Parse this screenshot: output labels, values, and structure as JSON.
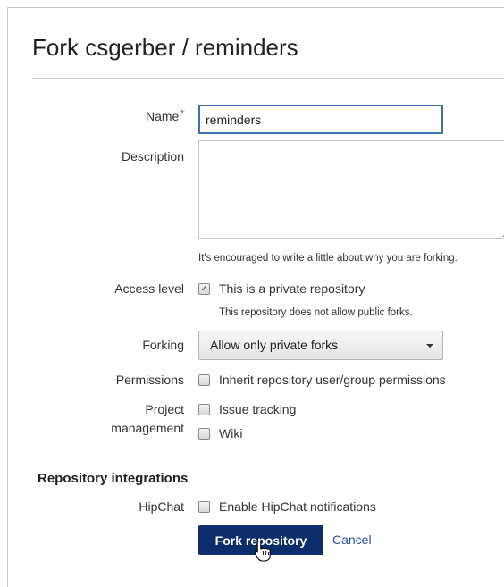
{
  "page": {
    "title": "Fork csgerber / reminders"
  },
  "form": {
    "name_label": "Name",
    "required_mark": "*",
    "name_value": "reminders",
    "description_label": "Description",
    "description_value": "",
    "description_help": "It's encouraged to write a little about why you are forking.",
    "access_label": "Access level",
    "access_checkbox_label": "This is a private repository",
    "access_checked": true,
    "access_help": "This repository does not allow public forks.",
    "forking_label": "Forking",
    "forking_selected": "Allow only private forks",
    "permissions_label": "Permissions",
    "permissions_checkbox_label": "Inherit repository user/group permissions",
    "project_label_line1": "Project",
    "project_label_line2": "management",
    "issue_tracking_label": "Issue tracking",
    "wiki_label": "Wiki"
  },
  "integrations": {
    "heading": "Repository integrations",
    "hipchat_label": "HipChat",
    "hipchat_checkbox_label": "Enable HipChat notifications"
  },
  "actions": {
    "fork_label": "Fork repository",
    "cancel_label": "Cancel"
  },
  "colors": {
    "primary_button": "#0b2d6b",
    "focus_border": "#3b73af",
    "required": "#d04437",
    "link": "#1f4fa8"
  }
}
